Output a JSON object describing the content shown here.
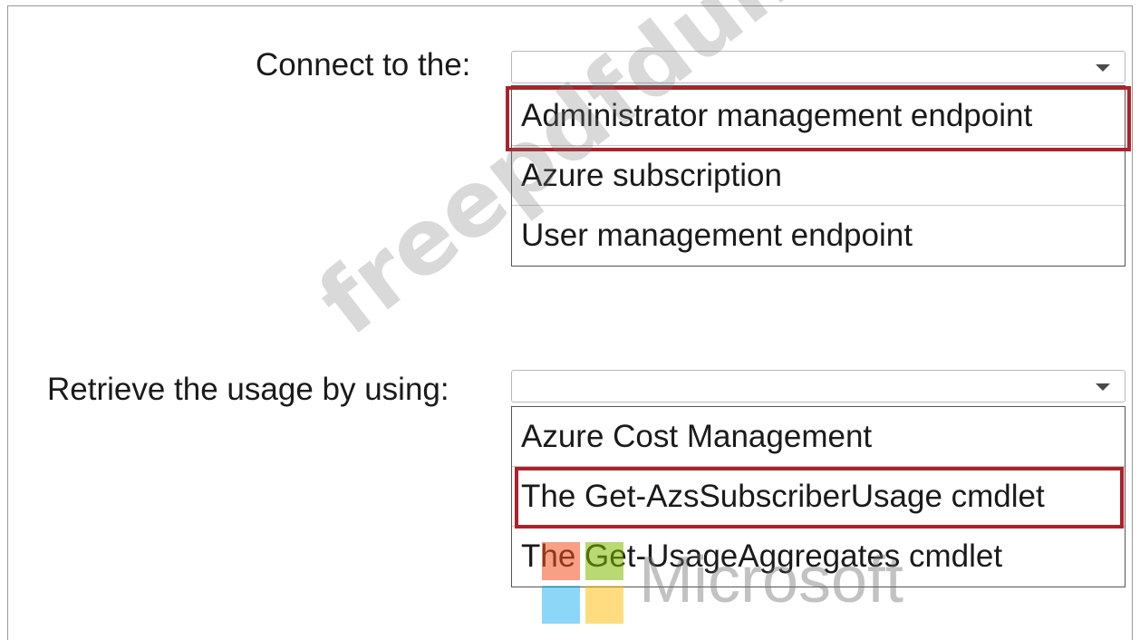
{
  "colors": {
    "highlight": "#b0202a",
    "ms_red": "#f25022",
    "ms_green": "#7fba00",
    "ms_blue": "#00a4ef",
    "ms_yellow": "#ffb900"
  },
  "q1": {
    "label": "Connect to the:",
    "selected": "",
    "options": [
      "Administrator management endpoint",
      "Azure subscription",
      "User management endpoint"
    ],
    "highlighted_option": "Administrator management endpoint"
  },
  "q2": {
    "label": "Retrieve the usage by using:",
    "selected": "",
    "options": [
      "Azure Cost Management",
      "The Get-AzsSubscriberUsage cmdlet",
      "The Get-UsageAggregates cmdlet"
    ],
    "highlighted_option": "The Get-AzsSubscriberUsage cmdlet"
  },
  "watermark": {
    "text": "freepdfdumps.com",
    "brand_logo": "microsoft-logo",
    "brand_name": "Microsoft"
  }
}
